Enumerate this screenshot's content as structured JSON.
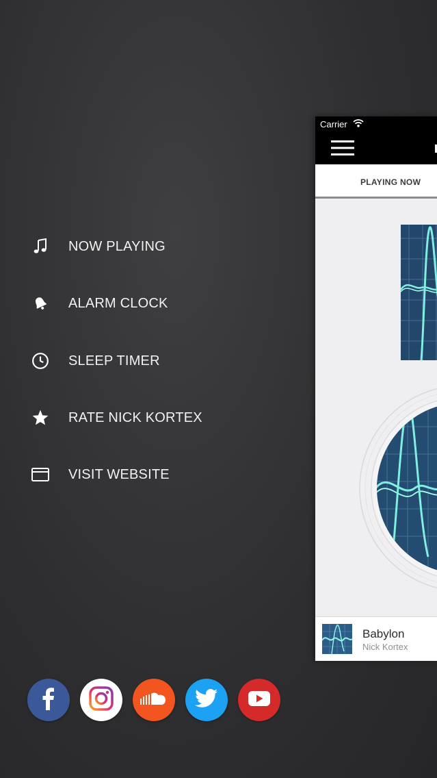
{
  "menu": {
    "items": [
      {
        "label": "NOW PLAYING",
        "icon": "music-note-icon"
      },
      {
        "label": "ALARM CLOCK",
        "icon": "bell-icon"
      },
      {
        "label": "SLEEP TIMER",
        "icon": "clock-icon"
      },
      {
        "label": "RATE NICK KORTEX",
        "icon": "star-icon"
      },
      {
        "label": "VISIT WEBSITE",
        "icon": "browser-window-icon"
      }
    ]
  },
  "social": [
    {
      "name": "facebook",
      "icon": "facebook-icon",
      "color": "#3b5998"
    },
    {
      "name": "instagram",
      "icon": "instagram-icon",
      "color": "#ffffff"
    },
    {
      "name": "soundcloud",
      "icon": "soundcloud-icon",
      "color": "#f2551f"
    },
    {
      "name": "twitter",
      "icon": "twitter-icon",
      "color": "#1da1f2"
    },
    {
      "name": "youtube",
      "icon": "youtube-icon",
      "color": "#d42a2a"
    }
  ],
  "app": {
    "status": {
      "carrier": "Carrier"
    },
    "tab": {
      "label": "PLAYING NOW"
    },
    "player": {
      "title": "Babylon",
      "artist": "Nick Kortex"
    }
  },
  "colors": {
    "background": "#333335",
    "menu_text": "#f2f2f2",
    "navbar": "#000000",
    "panel": "#efeff1"
  }
}
